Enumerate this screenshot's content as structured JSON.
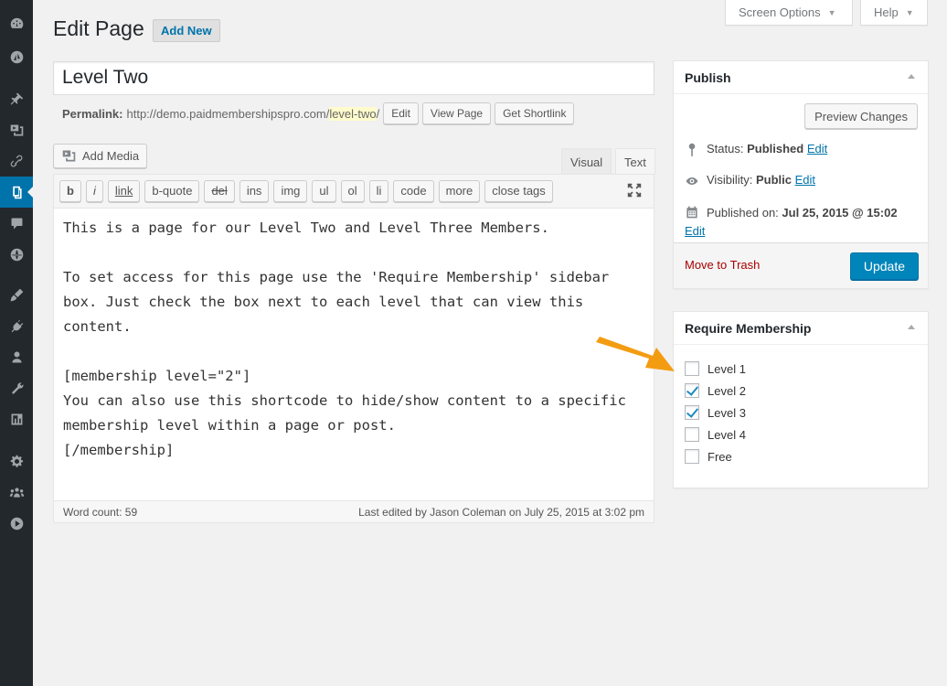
{
  "screen_meta": {
    "screen_options": "Screen Options",
    "help": "Help"
  },
  "header": {
    "title": "Edit Page",
    "add_new": "Add New"
  },
  "post": {
    "title": "Level Two",
    "permalink_label": "Permalink:",
    "permalink_base": "http://demo.paidmembershipspro.com/",
    "permalink_slug": "level-two",
    "permalink_tail": "/",
    "edit_btn": "Edit",
    "view_btn": "View Page",
    "shortlink_btn": "Get Shortlink"
  },
  "editor": {
    "add_media": "Add Media",
    "tab_visual": "Visual",
    "tab_text": "Text",
    "toolbar": [
      "b",
      "i",
      "link",
      "b-quote",
      "del",
      "ins",
      "img",
      "ul",
      "ol",
      "li",
      "code",
      "more",
      "close tags"
    ],
    "content": "This is a page for our Level Two and Level Three Members.\n\nTo set access for this page use the 'Require Membership' sidebar box. Just check the box next to each level that can view this content.\n\n[membership level=\"2\"]\nYou can also use this shortcode to hide/show content to a specific membership level within a page or post.\n[/membership]",
    "word_count": "Word count: 59",
    "last_edited": "Last edited by Jason Coleman on July 25, 2015 at 3:02 pm"
  },
  "publish": {
    "title": "Publish",
    "preview": "Preview Changes",
    "status_label": "Status:",
    "status_value": "Published",
    "visibility_label": "Visibility:",
    "visibility_value": "Public",
    "published_label": "Published on:",
    "published_value": "Jul 25, 2015 @ 15:02",
    "edit": "Edit",
    "trash": "Move to Trash",
    "update": "Update"
  },
  "membership": {
    "title": "Require Membership",
    "levels": [
      {
        "label": "Level 1",
        "checked": false
      },
      {
        "label": "Level 2",
        "checked": true
      },
      {
        "label": "Level 3",
        "checked": true
      },
      {
        "label": "Level 4",
        "checked": false
      },
      {
        "label": "Free",
        "checked": false
      }
    ]
  },
  "colors": {
    "sidebar": "#23282d",
    "accent": "#0073aa",
    "update": "#0085ba",
    "arrow": "#f39c12",
    "trash": "#aa0000"
  },
  "sidebar_icons": [
    "dashboard-icon",
    "jetpack-icon",
    "posts-icon",
    "media-icon",
    "links-icon",
    "pages-icon",
    "comments-icon",
    "memberships-icon",
    "appearance-icon",
    "plugins-icon",
    "users-icon",
    "tools-icon",
    "settings-icon",
    "gear-icon",
    "groups-icon",
    "video-icon"
  ]
}
